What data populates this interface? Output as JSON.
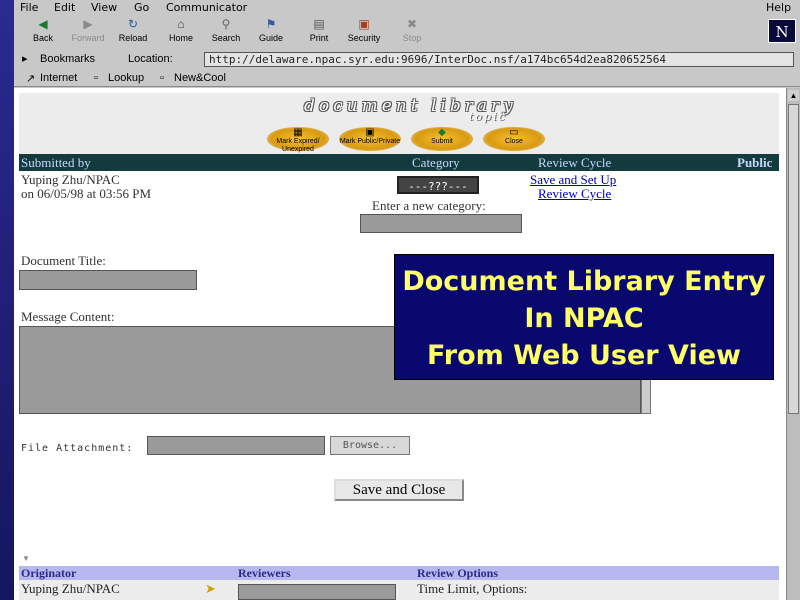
{
  "menu": [
    "File",
    "Edit",
    "View",
    "Go",
    "Communicator"
  ],
  "help_label": "Help",
  "toolbar": [
    {
      "label": "Back",
      "icon": "back-arrow-icon",
      "enabled": true
    },
    {
      "label": "Forward",
      "icon": "forward-arrow-icon",
      "enabled": false
    },
    {
      "label": "Reload",
      "icon": "reload-icon",
      "enabled": true
    },
    {
      "label": "Home",
      "icon": "home-icon",
      "enabled": true
    },
    {
      "label": "Search",
      "icon": "search-icon",
      "enabled": true
    },
    {
      "label": "Guide",
      "icon": "guide-icon",
      "enabled": true
    },
    {
      "label": "Print",
      "icon": "print-icon",
      "enabled": true
    },
    {
      "label": "Security",
      "icon": "lock-icon",
      "enabled": true
    },
    {
      "label": "Stop",
      "icon": "stop-icon",
      "enabled": false
    }
  ],
  "logo_letter": "N",
  "location": {
    "bookmarks_label": "Bookmarks",
    "location_label": "Location:",
    "url": "http://delaware.npac.syr.edu:9696/InterDoc.nsf/a174bc654d2ea820652564"
  },
  "personal_toolbar": [
    "Internet",
    "Lookup",
    "New&Cool"
  ],
  "page": {
    "banner_title": "document library",
    "banner_subtitle": "topic",
    "actions": [
      {
        "label": "Mark Expired/ Unexpired",
        "icon": "document-icon"
      },
      {
        "label": "Mark Public/Private",
        "icon": "lock-icon"
      },
      {
        "label": "Submit",
        "icon": "submit-icon"
      },
      {
        "label": "Close",
        "icon": "close-icon"
      }
    ],
    "headers": {
      "submitted_by": "Submitted by",
      "category": "Category",
      "review_cycle": "Review Cycle",
      "public": "Public"
    },
    "submitter": "Yuping Zhu/NPAC",
    "submitted_on": "on 06/05/98 at 03:56 PM",
    "category_value": "---???---",
    "new_category_label": "Enter a new category:",
    "save_setup_link": "Save and Set Up",
    "review_cycle_link": "Review Cycle",
    "doc_title_label": "Document Title:",
    "message_label": "Message Content:",
    "file_attach_label": "File Attachment:",
    "browse_label": "Browse...",
    "save_close_label": "Save and Close",
    "footer_headers": {
      "originator": "Originator",
      "reviewers": "Reviewers",
      "review_options": "Review Options"
    },
    "originator": "Yuping Zhu/NPAC",
    "review_options_value": "Time Limit, Options:"
  },
  "overlay": {
    "line1": "Document Library Entry",
    "line2": "In NPAC",
    "line3": "From Web User View"
  }
}
